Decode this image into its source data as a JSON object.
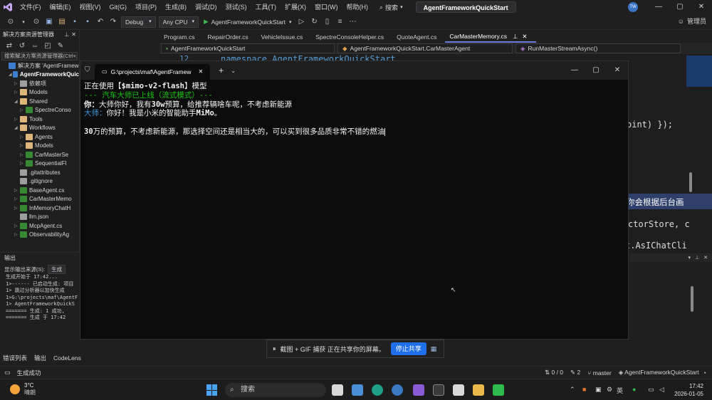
{
  "menu": {
    "items": [
      "文件(F)",
      "编辑(E)",
      "视图(V)",
      "Git(G)",
      "项目(P)",
      "生成(B)",
      "调试(D)",
      "测试(S)",
      "工具(T)",
      "扩展(X)",
      "窗口(W)",
      "帮助(H)"
    ],
    "search_label": "搜索",
    "solution_name": "AgentFrameworkQuickStart",
    "avatar_initials": "TW",
    "window_controls": [
      "—",
      "▢",
      "✕"
    ]
  },
  "toolbar": {
    "config": "Debug",
    "platform": "Any CPU",
    "run_target": "AgentFrameworkQuickStart",
    "admin_label": "管理员"
  },
  "solution_explorer": {
    "title": "解决方案资源管理器",
    "search_placeholder": "搜索解决方案资源管理器(Ctrl+;)",
    "items": [
      {
        "label": "解决方案 'AgentFramew",
        "indent": 0,
        "kind": "proj",
        "arrow": "",
        "bold": false
      },
      {
        "label": "AgentFrameworkQuic",
        "indent": 1,
        "kind": "proj",
        "arrow": "◢",
        "bold": true
      },
      {
        "label": "依赖项",
        "indent": 2,
        "kind": "file",
        "arrow": "▷",
        "bold": false
      },
      {
        "label": "Models",
        "indent": 2,
        "kind": "folder",
        "arrow": "▷",
        "bold": false
      },
      {
        "label": "Shared",
        "indent": 2,
        "kind": "folder",
        "arrow": "◢",
        "bold": false
      },
      {
        "label": "SpectreConso",
        "indent": 3,
        "kind": "csfile",
        "arrow": "▷",
        "bold": false
      },
      {
        "label": "Tools",
        "indent": 2,
        "kind": "folder",
        "arrow": "▷",
        "bold": false
      },
      {
        "label": "Workflows",
        "indent": 2,
        "kind": "folder",
        "arrow": "◢",
        "bold": false
      },
      {
        "label": "Agents",
        "indent": 3,
        "kind": "folder",
        "arrow": "▷",
        "bold": false
      },
      {
        "label": "Models",
        "indent": 3,
        "kind": "folder",
        "arrow": "▷",
        "bold": false
      },
      {
        "label": "CarMasterSe",
        "indent": 3,
        "kind": "csfile",
        "arrow": "▷",
        "bold": false
      },
      {
        "label": "SequentialFl",
        "indent": 3,
        "kind": "csfile",
        "arrow": "▷",
        "bold": false
      },
      {
        "label": ".gitattributes",
        "indent": 2,
        "kind": "file",
        "arrow": "",
        "bold": false
      },
      {
        "label": ".gitignore",
        "indent": 2,
        "kind": "file",
        "arrow": "",
        "bold": false
      },
      {
        "label": "BaseAgent.cs",
        "indent": 2,
        "kind": "csfile",
        "arrow": "▷",
        "bold": false
      },
      {
        "label": "CarMasterMemo",
        "indent": 2,
        "kind": "csfile",
        "arrow": "▷",
        "bold": false
      },
      {
        "label": "InMemoryChatH",
        "indent": 2,
        "kind": "csfile",
        "arrow": "▷",
        "bold": false
      },
      {
        "label": "llm.json",
        "indent": 2,
        "kind": "file",
        "arrow": "",
        "bold": false
      },
      {
        "label": "McpAgent.cs",
        "indent": 2,
        "kind": "csfile",
        "arrow": "▷",
        "bold": false
      },
      {
        "label": "ObservabilityAg",
        "indent": 2,
        "kind": "csfile",
        "arrow": "▷",
        "bold": false
      }
    ]
  },
  "output": {
    "title": "输出",
    "source_label": "显示输出来源(S):",
    "source_value": "生成",
    "lines": [
      "生成开始于 17:42...",
      "1>------ 已启动生成: 项目",
      "1>  跳过分析器以加快生成",
      "1>G:\\projects\\maf\\AgentF",
      "1>  AgentFrameworkQuickS",
      "======= 生成: 1 成功,",
      "======= 生成 于 17:42"
    ]
  },
  "editor": {
    "tabs": [
      "Program.cs",
      "RepairOrder.cs",
      "VehicleIssue.cs",
      "SpectreConsoleHelper.cs",
      "QuoteAgent.cs",
      "CarMasterMemory.cs"
    ],
    "active_tab": "CarMasterMemory.cs",
    "nav": [
      "AgentFrameworkQuickStart",
      "AgentFrameworkQuickStart.CarMasterAgent",
      "RunMasterStreamAsync()"
    ],
    "line_number": "12",
    "code_top": "namespace AgentFrameworkQuickStart",
    "code_frag1": "oint) });",
    "code_frag2": "你会根据后台画",
    "code_frag3": "ctorStore, c",
    "code_frag4": "t.AsIChatCli"
  },
  "console": {
    "title": "G:\\projects\\maf\\AgentFramew",
    "line1_prefix": "正在使用【",
    "line1_model": "$mimo-v2-flash",
    "line1_suffix": "】模型",
    "line2": "--- 汽车大师已上线（流式模式）---",
    "user_label": "你：",
    "user_text": "大师你好，我有",
    "user_budget": "30w",
    "user_text2": "预算，给推荐辆啥车呢，不考虑新能源",
    "master_label": "大师：",
    "master_text": "你好！我是小米的智能助手",
    "master_name": "MiMo",
    "master_end": "。",
    "stream_num": "30",
    "stream_text": "万的预算，不考虑新能源，那选择空间还是相当大的，可以买到很多品质非常不错的燃油"
  },
  "share_bar": {
    "text": "截图 + GIF 捕获 正在共享你的屏幕。",
    "stop_label": "停止共享"
  },
  "bottom_tabs": [
    "错误列表",
    "输出",
    "CodeLens"
  ],
  "status": {
    "left": "生成成功",
    "changes": "0 / 0",
    "edits": "2",
    "branch": "master",
    "repo": "AgentFrameworkQuickStart"
  },
  "taskbar": {
    "temp": "3°C",
    "weather": "晴朗",
    "search": "搜索",
    "ime": "英",
    "time": "17:42",
    "date": "2026-01-05"
  }
}
